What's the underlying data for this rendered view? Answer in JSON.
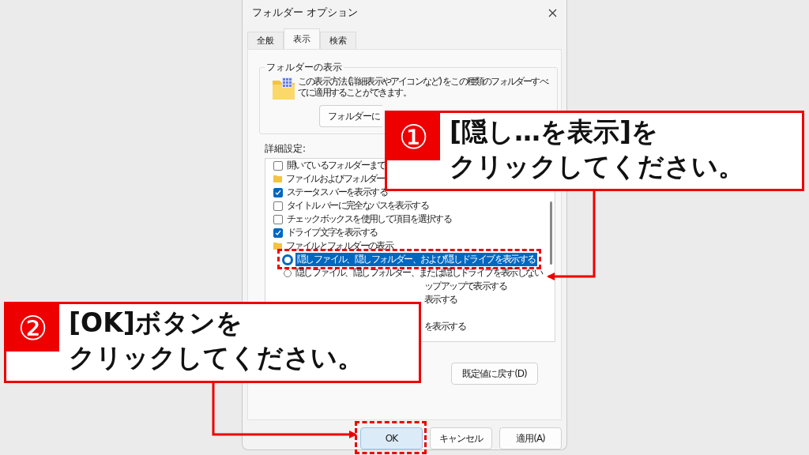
{
  "window": {
    "title": "フォルダー オプション"
  },
  "tabs": [
    {
      "label": "全般",
      "selected": false
    },
    {
      "label": "表示",
      "selected": true
    },
    {
      "label": "検索",
      "selected": false
    }
  ],
  "folder_views": {
    "title": "フォルダーの表示",
    "description": "この表示方法 (詳細表示やアイコンなど) をこの種類のフォルダーすべてに適用することができます。",
    "apply_button": "フォルダーに"
  },
  "advanced": {
    "label": "詳細設定:",
    "items": [
      {
        "kind": "checkbox",
        "text": "開いているフォルダーまで",
        "checked": false
      },
      {
        "kind": "folder",
        "text": "ファイルおよびフォルダー"
      },
      {
        "kind": "checkbox",
        "text": "ステータス バーを表示する",
        "checked": true
      },
      {
        "kind": "checkbox",
        "text": "タイトル バーに完全なパスを表示する",
        "checked": false
      },
      {
        "kind": "checkbox",
        "text": "チェックボックスを使用して項目を選択する",
        "checked": false
      },
      {
        "kind": "checkbox",
        "text": "ドライブ文字を表示する",
        "checked": true
      },
      {
        "kind": "folder",
        "text": "ファイルとフォルダーの表示"
      },
      {
        "kind": "radio",
        "text": "隠しファイル、隠しフォルダー、および隠しドライブを表示する",
        "selected": true
      },
      {
        "kind": "radio",
        "text": "隠しファイル、隠しフォルダー、または隠しドライブを表示しない",
        "selected": false
      },
      {
        "kind": "tail",
        "text": "ップアップで表示する"
      },
      {
        "kind": "tail",
        "text": "表示する"
      },
      {
        "kind": "covered"
      },
      {
        "kind": "tail",
        "text": "を表示する"
      }
    ]
  },
  "restore_button": "既定値に戻す(D)",
  "buttons": [
    {
      "label": "OK",
      "selected": true
    },
    {
      "label": "キャンセル",
      "selected": false
    },
    {
      "label": "適用(A)",
      "selected": false
    }
  ],
  "callouts": [
    {
      "number": "①",
      "lines": [
        "[隠し…を表示]を",
        "クリックしてください。"
      ]
    },
    {
      "number": "②",
      "lines": [
        "[OK]ボタンを",
        "クリックしてください。"
      ]
    }
  ]
}
